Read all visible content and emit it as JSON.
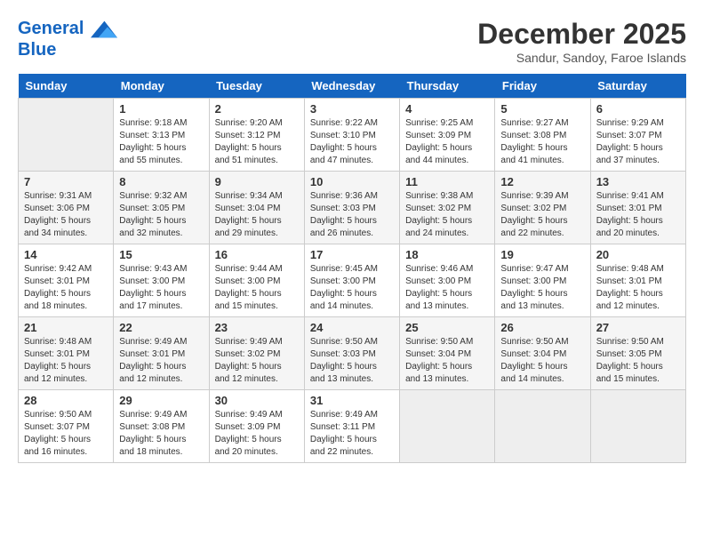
{
  "header": {
    "logo_line1": "General",
    "logo_line2": "Blue",
    "month": "December 2025",
    "location": "Sandur, Sandoy, Faroe Islands"
  },
  "weekdays": [
    "Sunday",
    "Monday",
    "Tuesday",
    "Wednesday",
    "Thursday",
    "Friday",
    "Saturday"
  ],
  "weeks": [
    [
      {
        "day": "",
        "empty": true
      },
      {
        "day": "1",
        "sunrise": "9:18 AM",
        "sunset": "3:13 PM",
        "daylight": "5 hours and 55 minutes."
      },
      {
        "day": "2",
        "sunrise": "9:20 AM",
        "sunset": "3:12 PM",
        "daylight": "5 hours and 51 minutes."
      },
      {
        "day": "3",
        "sunrise": "9:22 AM",
        "sunset": "3:10 PM",
        "daylight": "5 hours and 47 minutes."
      },
      {
        "day": "4",
        "sunrise": "9:25 AM",
        "sunset": "3:09 PM",
        "daylight": "5 hours and 44 minutes."
      },
      {
        "day": "5",
        "sunrise": "9:27 AM",
        "sunset": "3:08 PM",
        "daylight": "5 hours and 41 minutes."
      },
      {
        "day": "6",
        "sunrise": "9:29 AM",
        "sunset": "3:07 PM",
        "daylight": "5 hours and 37 minutes."
      }
    ],
    [
      {
        "day": "7",
        "sunrise": "9:31 AM",
        "sunset": "3:06 PM",
        "daylight": "5 hours and 34 minutes."
      },
      {
        "day": "8",
        "sunrise": "9:32 AM",
        "sunset": "3:05 PM",
        "daylight": "5 hours and 32 minutes."
      },
      {
        "day": "9",
        "sunrise": "9:34 AM",
        "sunset": "3:04 PM",
        "daylight": "5 hours and 29 minutes."
      },
      {
        "day": "10",
        "sunrise": "9:36 AM",
        "sunset": "3:03 PM",
        "daylight": "5 hours and 26 minutes."
      },
      {
        "day": "11",
        "sunrise": "9:38 AM",
        "sunset": "3:02 PM",
        "daylight": "5 hours and 24 minutes."
      },
      {
        "day": "12",
        "sunrise": "9:39 AM",
        "sunset": "3:02 PM",
        "daylight": "5 hours and 22 minutes."
      },
      {
        "day": "13",
        "sunrise": "9:41 AM",
        "sunset": "3:01 PM",
        "daylight": "5 hours and 20 minutes."
      }
    ],
    [
      {
        "day": "14",
        "sunrise": "9:42 AM",
        "sunset": "3:01 PM",
        "daylight": "5 hours and 18 minutes."
      },
      {
        "day": "15",
        "sunrise": "9:43 AM",
        "sunset": "3:00 PM",
        "daylight": "5 hours and 17 minutes."
      },
      {
        "day": "16",
        "sunrise": "9:44 AM",
        "sunset": "3:00 PM",
        "daylight": "5 hours and 15 minutes."
      },
      {
        "day": "17",
        "sunrise": "9:45 AM",
        "sunset": "3:00 PM",
        "daylight": "5 hours and 14 minutes."
      },
      {
        "day": "18",
        "sunrise": "9:46 AM",
        "sunset": "3:00 PM",
        "daylight": "5 hours and 13 minutes."
      },
      {
        "day": "19",
        "sunrise": "9:47 AM",
        "sunset": "3:00 PM",
        "daylight": "5 hours and 13 minutes."
      },
      {
        "day": "20",
        "sunrise": "9:48 AM",
        "sunset": "3:01 PM",
        "daylight": "5 hours and 12 minutes."
      }
    ],
    [
      {
        "day": "21",
        "sunrise": "9:48 AM",
        "sunset": "3:01 PM",
        "daylight": "5 hours and 12 minutes."
      },
      {
        "day": "22",
        "sunrise": "9:49 AM",
        "sunset": "3:01 PM",
        "daylight": "5 hours and 12 minutes."
      },
      {
        "day": "23",
        "sunrise": "9:49 AM",
        "sunset": "3:02 PM",
        "daylight": "5 hours and 12 minutes."
      },
      {
        "day": "24",
        "sunrise": "9:50 AM",
        "sunset": "3:03 PM",
        "daylight": "5 hours and 13 minutes."
      },
      {
        "day": "25",
        "sunrise": "9:50 AM",
        "sunset": "3:04 PM",
        "daylight": "5 hours and 13 minutes."
      },
      {
        "day": "26",
        "sunrise": "9:50 AM",
        "sunset": "3:04 PM",
        "daylight": "5 hours and 14 minutes."
      },
      {
        "day": "27",
        "sunrise": "9:50 AM",
        "sunset": "3:05 PM",
        "daylight": "5 hours and 15 minutes."
      }
    ],
    [
      {
        "day": "28",
        "sunrise": "9:50 AM",
        "sunset": "3:07 PM",
        "daylight": "5 hours and 16 minutes."
      },
      {
        "day": "29",
        "sunrise": "9:49 AM",
        "sunset": "3:08 PM",
        "daylight": "5 hours and 18 minutes."
      },
      {
        "day": "30",
        "sunrise": "9:49 AM",
        "sunset": "3:09 PM",
        "daylight": "5 hours and 20 minutes."
      },
      {
        "day": "31",
        "sunrise": "9:49 AM",
        "sunset": "3:11 PM",
        "daylight": "5 hours and 22 minutes."
      },
      {
        "day": "",
        "empty": true
      },
      {
        "day": "",
        "empty": true
      },
      {
        "day": "",
        "empty": true
      }
    ]
  ]
}
